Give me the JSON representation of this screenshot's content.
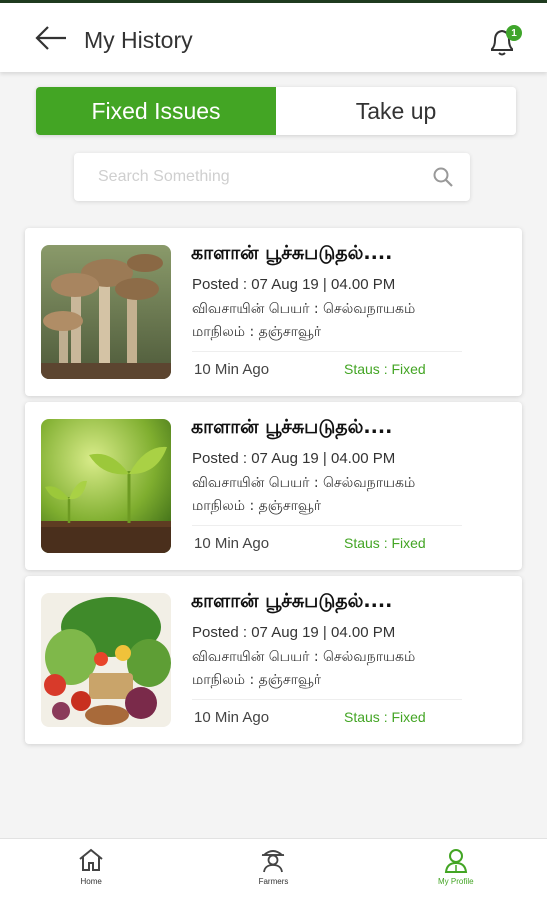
{
  "header": {
    "title": "My History",
    "notification_count": "1",
    "back_icon": "arrow-left-icon",
    "bell_icon": "bell-icon"
  },
  "tabs": [
    {
      "label": "Fixed Issues",
      "active": true
    },
    {
      "label": "Take up",
      "active": false
    }
  ],
  "search": {
    "placeholder": "Search Something",
    "value": "",
    "icon": "search-icon"
  },
  "issues": [
    {
      "title": "காளான் பூச்சுபடுதல்....",
      "posted": "Posted : 07 Aug 19 | 04.00 PM",
      "farmer": "விவசாயின் பெயர் : செல்வநாயகம்",
      "district": "மாநிலம் : தஞ்சாவூர்",
      "ago": "10 Min Ago",
      "status": "Staus : Fixed",
      "image": "mushrooms-image"
    },
    {
      "title": "காளான் பூச்சுபடுதல்....",
      "posted": "Posted : 07 Aug 19 | 04.00 PM",
      "farmer": "விவசாயின் பெயர் : செல்வநாயகம்",
      "district": "மாநிலம் : தஞ்சாவூர்",
      "ago": "10 Min Ago",
      "status": "Staus : Fixed",
      "image": "seedlings-image"
    },
    {
      "title": "காளான் பூச்சுபடுதல்....",
      "posted": "Posted : 07 Aug 19 | 04.00 PM",
      "farmer": "விவசாயின் பெயர் : செல்வநாயகம்",
      "district": "மாநிலம் : தஞ்சாவூர்",
      "ago": "10 Min Ago",
      "status": "Staus : Fixed",
      "image": "vegetables-image"
    }
  ],
  "bottom_nav": [
    {
      "label": "Home",
      "icon": "home-icon",
      "active": false
    },
    {
      "label": "Farmers",
      "icon": "farmer-icon",
      "active": false
    },
    {
      "label": "My Profile",
      "icon": "profile-icon",
      "active": true
    }
  ],
  "colors": {
    "accent": "#43a524",
    "background": "#f4f4f4",
    "card": "#ffffff"
  }
}
